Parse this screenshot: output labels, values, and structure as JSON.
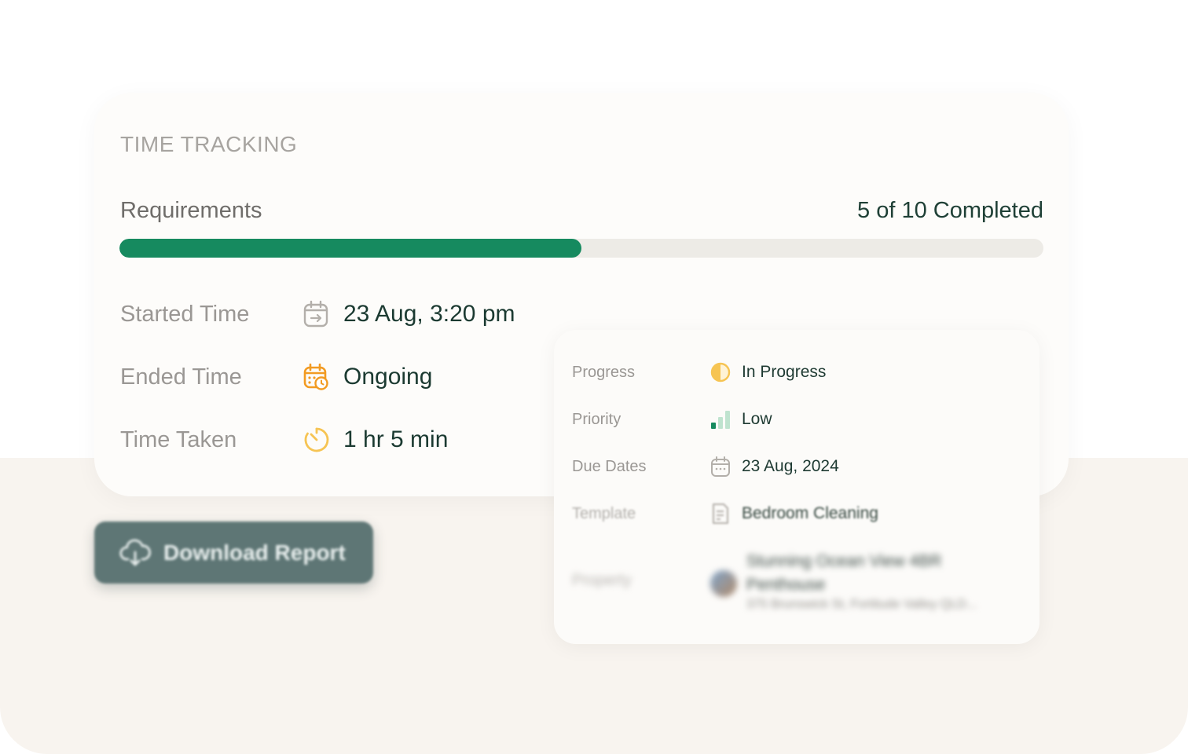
{
  "card": {
    "title": "TIME TRACKING",
    "requirements": {
      "label": "Requirements",
      "count_text": "5 of 10 Completed",
      "completed": 5,
      "total": 10,
      "progress_fraction": 0.5
    },
    "rows": {
      "started": {
        "label": "Started Time",
        "value": "23 Aug, 3:20 pm",
        "icon": "calendar-arrow-icon"
      },
      "ended": {
        "label": "Ended Time",
        "value": "Ongoing",
        "icon": "calendar-clock-icon"
      },
      "taken": {
        "label": "Time Taken",
        "value": "1 hr 5 min",
        "icon": "timer-icon"
      }
    }
  },
  "details": {
    "progress": {
      "label": "Progress",
      "value": "In Progress",
      "icon": "half-circle-icon"
    },
    "priority": {
      "label": "Priority",
      "value": "Low",
      "icon": "signal-bars-icon"
    },
    "due": {
      "label": "Due Dates",
      "value": "23 Aug, 2024",
      "icon": "calendar-icon"
    },
    "template": {
      "label": "Template",
      "value": "Bedroom Cleaning",
      "icon": "document-icon"
    },
    "property": {
      "label": "Property",
      "name": "Stunning Ocean View 4BR Penthouse",
      "address": "375 Brunswick St, Fortitude Valley QLD..."
    }
  },
  "download_button": {
    "label": "Download Report",
    "icon": "cloud-download-icon"
  },
  "colors": {
    "accent_green": "#168a5f",
    "track": "#edebe6",
    "warning_orange": "#f29b22",
    "progress_yellow": "#f6c453",
    "button_bg": "#5e7675"
  }
}
